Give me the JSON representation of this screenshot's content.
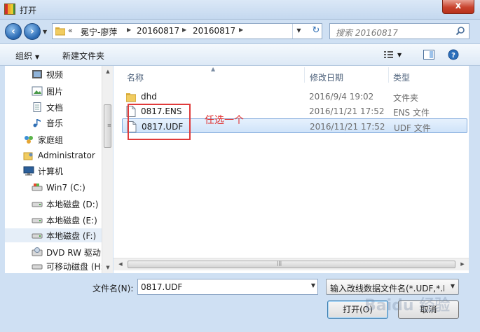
{
  "window": {
    "title": "打开",
    "close_label": "x"
  },
  "nav": {
    "back_icon": "back-arrow-icon",
    "forward_icon": "forward-arrow-icon",
    "address": {
      "overflow": "«",
      "segments": [
        "冕宁-廖萍",
        "20160817",
        "20160817"
      ]
    },
    "search_placeholder": "搜索 20160817"
  },
  "toolbar": {
    "organize_label": "组织",
    "new_folder_label": "新建文件夹"
  },
  "sidebar": {
    "items": [
      {
        "label": "视频",
        "icon": "video-icon",
        "indent": 1
      },
      {
        "label": "图片",
        "icon": "picture-icon",
        "indent": 1
      },
      {
        "label": "文档",
        "icon": "document-icon",
        "indent": 1
      },
      {
        "label": "音乐",
        "icon": "music-icon",
        "indent": 1
      },
      {
        "label": "家庭组",
        "icon": "homegroup-icon",
        "indent": 0
      },
      {
        "label": "Administrator",
        "icon": "user-folder-icon",
        "indent": 0
      },
      {
        "label": "计算机",
        "icon": "computer-icon",
        "indent": 0
      },
      {
        "label": "Win7 (C:)",
        "icon": "drive-icon",
        "indent": 1
      },
      {
        "label": "本地磁盘 (D:)",
        "icon": "drive-icon",
        "indent": 1
      },
      {
        "label": "本地磁盘 (E:)",
        "icon": "drive-icon",
        "indent": 1
      },
      {
        "label": "本地磁盘 (F:)",
        "icon": "drive-icon",
        "indent": 1,
        "selected": true
      },
      {
        "label": "DVD RW 驱动",
        "icon": "dvd-drive-icon",
        "indent": 1
      },
      {
        "label": "可移动磁盘 (H:",
        "icon": "removable-drive-icon",
        "indent": 1
      }
    ]
  },
  "files": {
    "columns": {
      "name": "名称",
      "date": "修改日期",
      "type": "类型"
    },
    "rows": [
      {
        "name": "dhd",
        "date": "2016/9/4 19:02",
        "type": "文件夹",
        "icon": "folder-icon"
      },
      {
        "name": "0817.ENS",
        "date": "2016/11/21 17:52",
        "type": "ENS 文件",
        "icon": "file-icon"
      },
      {
        "name": "0817.UDF",
        "date": "2016/11/21 17:52",
        "type": "UDF 文件",
        "icon": "file-icon",
        "selected": true
      }
    ],
    "annotation": "任选一个"
  },
  "footer": {
    "filename_label": "文件名(N):",
    "filename_value": "0817.UDF",
    "filter_value": "输入改线数据文件名(*.UDF,*.El",
    "open_label": "打开(O)",
    "cancel_label": "取消"
  },
  "watermark": "Baidu 经验",
  "colors": {
    "accent": "#3c7fb1",
    "annotation": "#e0302f",
    "selection": "#cfe3f9"
  }
}
